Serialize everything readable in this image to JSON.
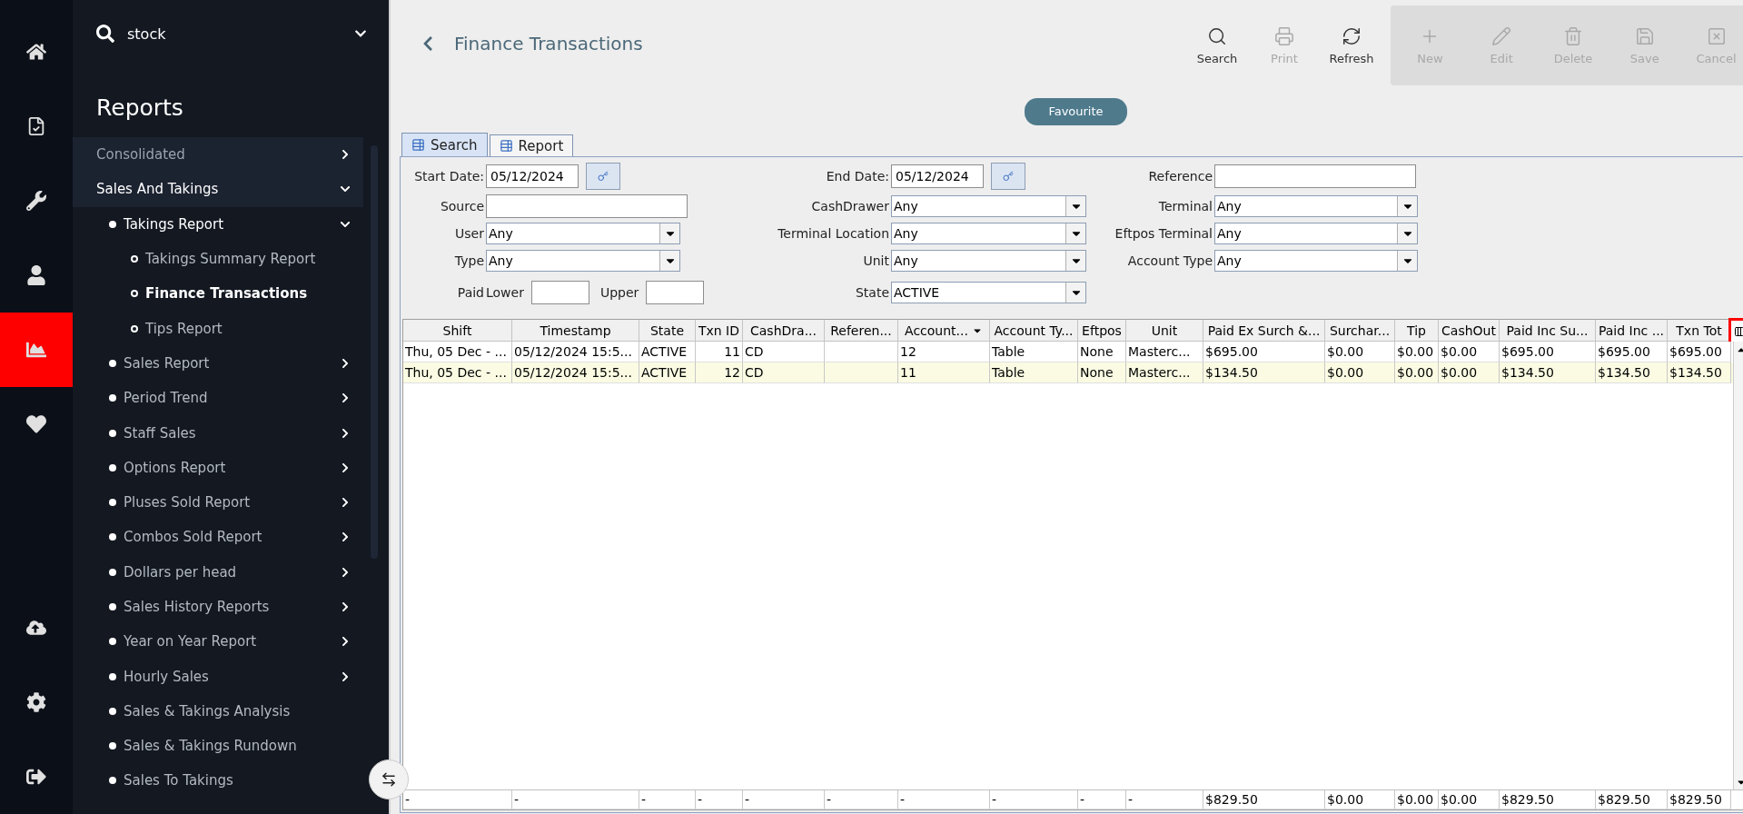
{
  "rail": [
    {
      "selected": false
    },
    {
      "selected": false
    },
    {
      "selected": false
    },
    {
      "selected": false
    },
    {
      "selected": true
    },
    {
      "selected": false
    },
    {
      "selected": false
    },
    {
      "selected": false
    },
    {
      "selected": false
    }
  ],
  "sidebar": {
    "search": {
      "value": "stock"
    },
    "heading": "Reports",
    "items": [
      {
        "label": "Consolidated",
        "expanded": false
      },
      {
        "label": "Sales And Takings",
        "expanded": true,
        "children": [
          {
            "label": "Takings Report",
            "expanded": true,
            "children": [
              {
                "label": "Takings Summary Report",
                "selected": false
              },
              {
                "label": "Finance Transactions",
                "selected": true
              },
              {
                "label": "Tips Report",
                "selected": false
              }
            ]
          },
          {
            "label": "Sales Report",
            "expanded": false
          },
          {
            "label": "Period Trend",
            "expanded": false
          },
          {
            "label": "Staff Sales",
            "expanded": false
          },
          {
            "label": "Options Report",
            "expanded": false
          },
          {
            "label": "Pluses Sold Report",
            "expanded": false
          },
          {
            "label": "Combos Sold Report",
            "expanded": false
          },
          {
            "label": "Dollars per head",
            "expanded": false
          },
          {
            "label": "Sales History Reports",
            "expanded": false
          },
          {
            "label": "Year on Year Report",
            "expanded": false
          },
          {
            "label": "Hourly Sales",
            "expanded": false
          },
          {
            "label": "Sales & Takings Analysis"
          },
          {
            "label": "Sales & Takings Rundown"
          },
          {
            "label": "Sales To Takings"
          }
        ]
      }
    ]
  },
  "title": "Finance Transactions",
  "toolbar": [
    {
      "label": "Search",
      "disabled": false
    },
    {
      "label": "Print",
      "disabled": true
    },
    {
      "label": "Refresh",
      "disabled": false
    }
  ],
  "edit_toolbar": [
    {
      "label": "New",
      "disabled": true
    },
    {
      "label": "Edit",
      "disabled": true
    },
    {
      "label": "Delete",
      "disabled": true
    },
    {
      "label": "Save",
      "disabled": true
    },
    {
      "label": "Cancel",
      "disabled": true
    }
  ],
  "favourite": "Favourite",
  "tabs": [
    {
      "label": "Search",
      "selected": true
    },
    {
      "label": "Report",
      "selected": false
    }
  ],
  "filter_rows": [
    [
      {
        "kind": "date",
        "label": "Start Date:",
        "value": "05/12/2024"
      },
      {
        "kind": "date",
        "label": "End Date:",
        "value": "05/12/2024"
      },
      {
        "kind": "text",
        "label": "Reference"
      }
    ],
    [
      {
        "kind": "text",
        "label": "Source"
      },
      {
        "kind": "select",
        "label": "CashDrawer",
        "value": "Any"
      },
      {
        "kind": "select",
        "label": "Terminal",
        "value": "Any"
      }
    ],
    [
      {
        "kind": "select",
        "label": "User",
        "value": "Any"
      },
      {
        "kind": "select",
        "label": "Terminal Location",
        "value": "Any"
      },
      {
        "kind": "select",
        "label": "Eftpos Terminal",
        "value": "Any"
      }
    ],
    [
      {
        "kind": "select",
        "label": "Type",
        "value": "Any"
      },
      {
        "kind": "select",
        "label": "Unit",
        "value": "Any"
      },
      {
        "kind": "select",
        "label": "Account Type",
        "value": "Any"
      }
    ],
    [
      {
        "kind": "range",
        "label": "Paid",
        "lower_label": "Lower",
        "upper_label": "Upper"
      },
      {
        "kind": "select",
        "label": "State",
        "value": "ACTIVE"
      }
    ]
  ],
  "table": {
    "columns": [
      {
        "label": "Shift",
        "sorted": false
      },
      {
        "label": "Timestamp",
        "sorted": false
      },
      {
        "label": "State",
        "sorted": false
      },
      {
        "label": "Txn ID",
        "sorted": false
      },
      {
        "label": "CashDra...",
        "sorted": false
      },
      {
        "label": "Referen...",
        "sorted": false
      },
      {
        "label": "Account...",
        "sorted": true
      },
      {
        "label": "Account Ty...",
        "sorted": false
      },
      {
        "label": "Eftpos",
        "sorted": false
      },
      {
        "label": "Unit",
        "sorted": false
      },
      {
        "label": "Paid Ex Surch &...",
        "sorted": false
      },
      {
        "label": "Surchar...",
        "sorted": false
      },
      {
        "label": "Tip",
        "sorted": false
      },
      {
        "label": "CashOut",
        "sorted": false
      },
      {
        "label": "Paid Inc Su...",
        "sorted": false
      },
      {
        "label": "Paid Inc ...",
        "sorted": false
      },
      {
        "label": "Txn Tot",
        "sorted": false
      }
    ],
    "rows": [
      {
        "selected": false,
        "cells": [
          "Thu, 05 Dec - ...",
          "05/12/2024 15:5...",
          "ACTIVE",
          "11",
          "CD",
          "",
          "12",
          "Table",
          "None",
          "Masterc...",
          "$695.00",
          "$0.00",
          "$0.00",
          "$0.00",
          "$695.00",
          "$695.00",
          "$695.00"
        ]
      },
      {
        "selected": true,
        "cells": [
          "Thu, 05 Dec - ...",
          "05/12/2024 15:5...",
          "ACTIVE",
          "12",
          "CD",
          "",
          "11",
          "Table",
          "None",
          "Masterc...",
          "$134.50",
          "$0.00",
          "$0.00",
          "$0.00",
          "$134.50",
          "$134.50",
          "$134.50"
        ]
      }
    ],
    "totals": [
      "-",
      "-",
      "-",
      "-",
      "-",
      "-",
      "-",
      "-",
      "-",
      "-",
      "$829.50",
      "$0.00",
      "$0.00",
      "$0.00",
      "$829.50",
      "$829.50",
      "$829.50"
    ]
  }
}
